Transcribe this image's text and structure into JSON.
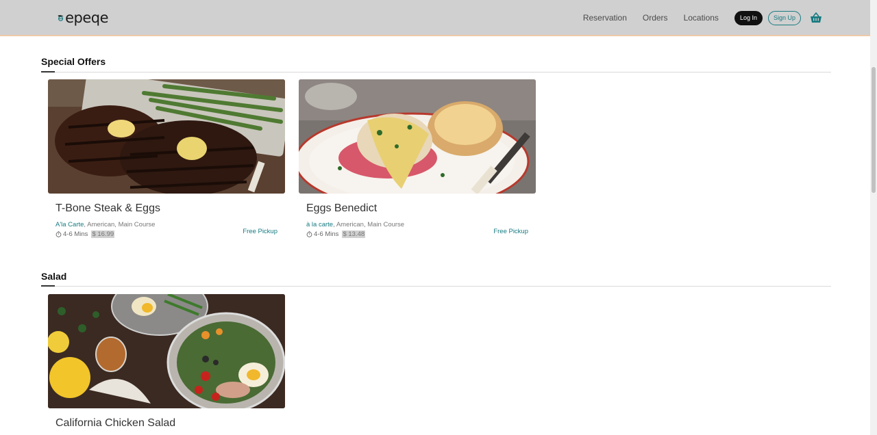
{
  "header": {
    "logo_text": "epeqe",
    "nav": [
      "Reservation",
      "Orders",
      "Locations"
    ],
    "login_label": "Log In",
    "signup_label": "Sign Up"
  },
  "sections": [
    {
      "title": "Special Offers",
      "items": [
        {
          "name": "T-Bone Steak & Eggs",
          "category": "A'la Carte",
          "meta": ", American, Main Course",
          "time": "4-6 Mins",
          "price": "$ 16.99",
          "pickup": "Free Pickup"
        },
        {
          "name": "Eggs Benedict",
          "category": "à la carte",
          "meta": ", American, Main Course",
          "time": "4-6 Mins",
          "price": "$ 13.48",
          "pickup": "Free Pickup"
        }
      ]
    },
    {
      "title": "Salad",
      "items": [
        {
          "name": "California Chicken Salad"
        }
      ]
    }
  ],
  "colors": {
    "accent": "#157a80",
    "header_bg": "#d0d0d0",
    "header_border": "#f0c9a8"
  }
}
